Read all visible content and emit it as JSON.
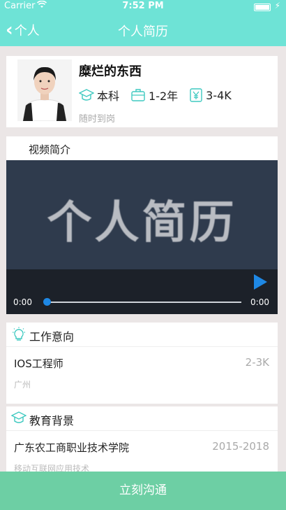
{
  "status": {
    "carrier": "Carrier",
    "time": "7:52 PM"
  },
  "nav": {
    "back_label": "个人",
    "title": "个人简历"
  },
  "profile": {
    "name": "糜烂的东西",
    "education": "本科",
    "experience": "1-2年",
    "salary": "3-4K",
    "availability": "随时到岗"
  },
  "video": {
    "section_label": "视频简介",
    "poster_text": "个人简历",
    "current_time": "0:00",
    "duration": "0:00",
    "progress": 0
  },
  "job_intent": {
    "section_label": "工作意向",
    "position": "IOS工程师",
    "salary": "2-3K",
    "city": "广州"
  },
  "education_bg": {
    "section_label": "教育背景",
    "school": "广东农工商职业技术学院",
    "years": "2015-2018",
    "major": "移动互联网应用技术"
  },
  "cta": {
    "label": "立刻沟通"
  },
  "colors": {
    "nav": "#6ee3d6",
    "accent": "#3fc9c0",
    "cta": "#6dcfa4",
    "progress": "#1e88e5"
  },
  "icons": [
    "wifi-icon",
    "battery-icon",
    "back-chevron-icon",
    "graduation-cap-icon",
    "briefcase-icon",
    "yen-icon",
    "lightbulb-icon",
    "play-icon"
  ]
}
